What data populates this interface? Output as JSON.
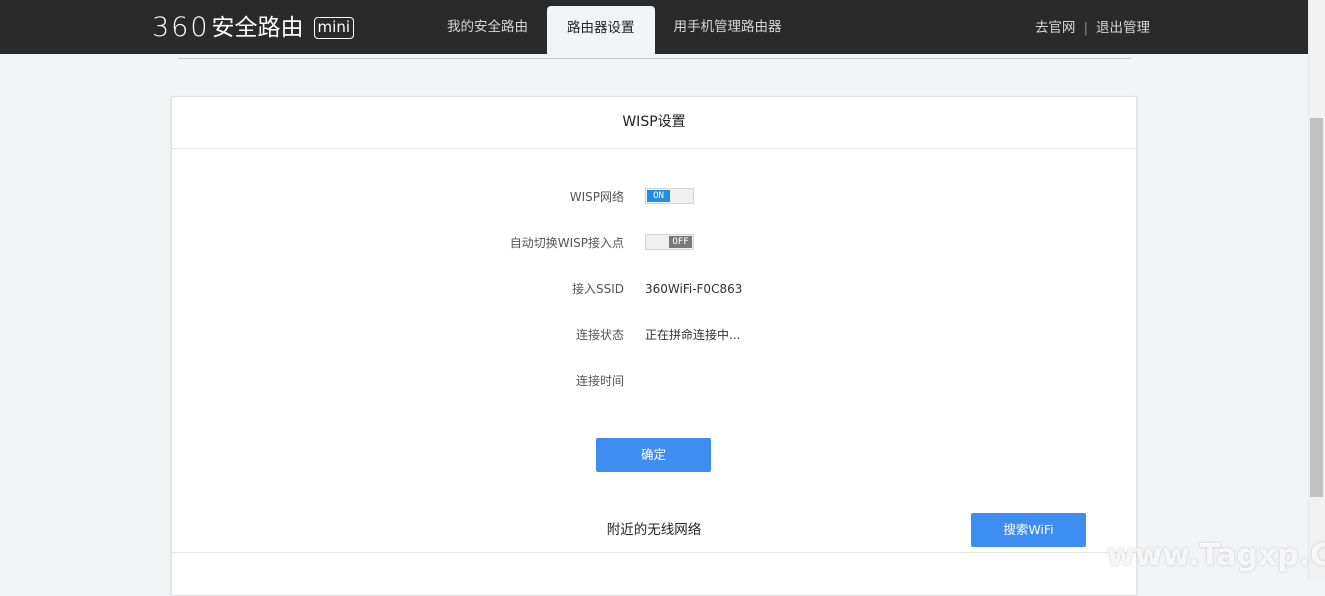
{
  "header": {
    "logo_num": "360",
    "logo_text": "安全路由",
    "logo_badge": "mini",
    "tabs": [
      {
        "label": "我的安全路由"
      },
      {
        "label": "路由器设置"
      },
      {
        "label": "用手机管理路由器"
      }
    ],
    "active_tab": "路由器设置",
    "links": {
      "official_site": "去官网",
      "separator": "|",
      "logout": "退出管理"
    }
  },
  "panel": {
    "title": "WISP设置",
    "wisp_network": {
      "label": "WISP网络",
      "state": "ON"
    },
    "auto_switch": {
      "label": "自动切换WISP接入点",
      "state": "OFF"
    },
    "ssid": {
      "label": "接入SSID",
      "value": "360WiFi-F0C863"
    },
    "status": {
      "label": "连接状态",
      "value": "正在拼命连接中..."
    },
    "time": {
      "label": "连接时间",
      "value": ""
    },
    "confirm_label": "确定",
    "nearby_title": "附近的无线网络",
    "search_wifi_label": "搜索WiFi"
  },
  "watermark": "www.Tagxp.Com",
  "colors": {
    "topbar": "#2a2a2a",
    "accent_blue": "#3d8ef0",
    "toggle_on": "#1e8fe1",
    "toggle_off": "#7a7a7a",
    "background": "#f2f3f5"
  }
}
